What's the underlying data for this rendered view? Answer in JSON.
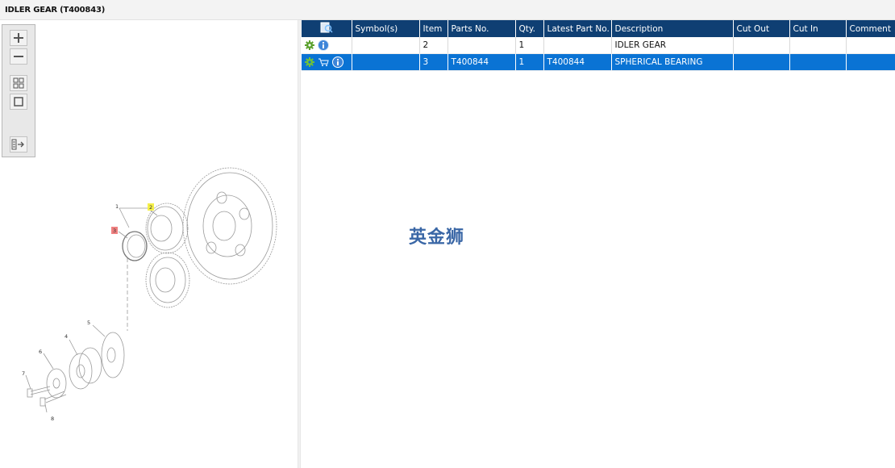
{
  "window": {
    "title": "IDLER GEAR (T400843)"
  },
  "toolbar": {
    "zoom_in": "zoom-in",
    "zoom_out": "zoom-out",
    "fit_page": "fit-page",
    "actual_size": "actual-size",
    "show_list": "show-parts-list"
  },
  "drawing": {
    "callouts": [
      "1",
      "2",
      "3",
      "4",
      "5",
      "6",
      "7",
      "8"
    ],
    "highlight_yellow": "#f5f04a",
    "highlight_red": "#f08080"
  },
  "table": {
    "columns": [
      "",
      "Symbol(s)",
      "Item",
      "Parts No.",
      "Qty.",
      "Latest Part No.",
      "Description",
      "Cut Out",
      "Cut In",
      "Comment"
    ],
    "rows": [
      {
        "item": "2",
        "parts_no": "",
        "qty": "1",
        "latest_part_no": "",
        "description": "IDLER GEAR",
        "cut_out": "",
        "cut_in": "",
        "comment": "",
        "selected": false,
        "has_cart": false
      },
      {
        "item": "3",
        "parts_no": "T400844",
        "qty": "1",
        "latest_part_no": "T400844",
        "description": "SPHERICAL BEARING",
        "cut_out": "",
        "cut_in": "",
        "comment": "",
        "selected": true,
        "has_cart": true
      }
    ],
    "header_color": "#0f3f73",
    "selected_color": "#0a73d4"
  },
  "watermark": "英金狮"
}
